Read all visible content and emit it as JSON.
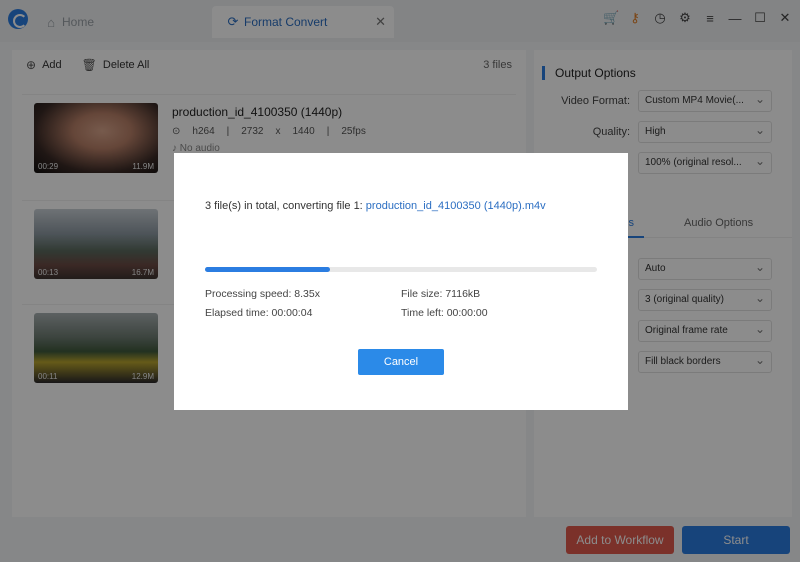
{
  "titlebar": {
    "tabs": [
      {
        "label": "Home",
        "icon": "home-icon"
      },
      {
        "label": "Format Convert",
        "icon": "refresh-icon"
      }
    ]
  },
  "toolbar": {
    "add_label": "Add",
    "delete_label": "Delete All",
    "file_count": "3 files"
  },
  "files": [
    {
      "name": "production_id_4100350 (1440p)",
      "codec": "h264",
      "width": "2732",
      "x": "x",
      "height": "1440",
      "fps": "25fps",
      "audio": "No audio",
      "duration": "00:29",
      "size": "11.9M"
    },
    {
      "name": "",
      "codec": "",
      "width": "",
      "x": "",
      "height": "",
      "fps": "",
      "audio": "",
      "duration": "00:13",
      "size": "16.7M"
    },
    {
      "name": "",
      "codec": "",
      "width": "",
      "x": "",
      "height": "",
      "fps": "",
      "audio": "",
      "duration": "00:11",
      "size": "12.9M"
    }
  ],
  "output_options": {
    "title": "Output Options",
    "video_format_label": "Video Format:",
    "video_format_value": "Custom MP4 Movie(...",
    "quality_label": "Quality:",
    "quality_value": "High",
    "resolution_value": "100% (original resol...",
    "subtab_audio": "Audio Options",
    "subtab_video_partial": "s",
    "selects": [
      "Auto",
      "3 (original quality)",
      "Original frame rate",
      "Fill black borders"
    ]
  },
  "buttons": {
    "workflow": "Add to Workflow",
    "start": "Start"
  },
  "dialog": {
    "message_prefix": "3 file(s) in total, converting file 1: ",
    "message_file": "production_id_4100350 (1440p).m4v",
    "progress_percent": 32,
    "processing_speed": "Processing speed: 8.35x",
    "file_size": "File size: 7116kB",
    "elapsed": "Elapsed time: 00:00:04",
    "time_left": "Time left: 00:00:00",
    "cancel_label": "Cancel"
  },
  "colors": {
    "accent": "#2b7de1",
    "workflow": "#e05a4e"
  }
}
